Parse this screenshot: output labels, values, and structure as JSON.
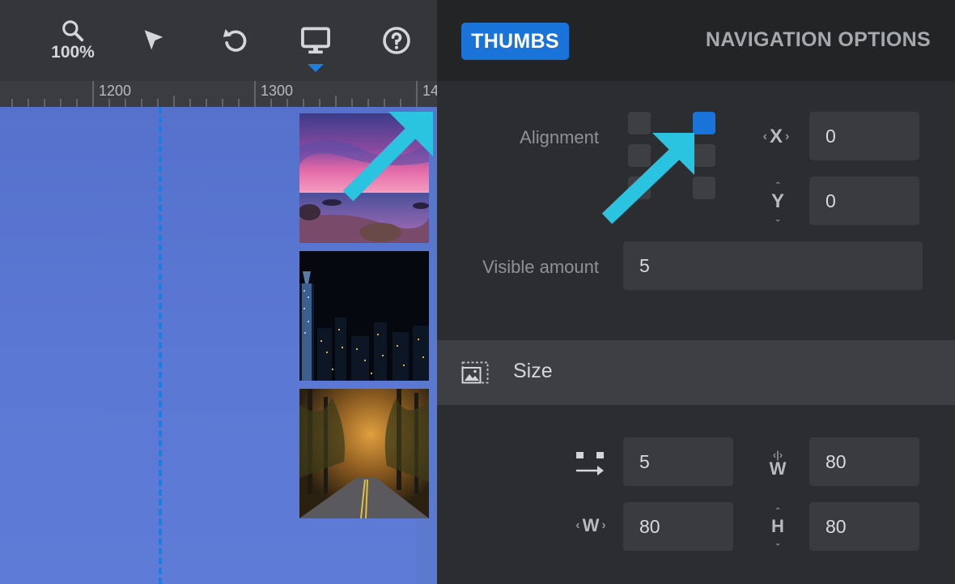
{
  "toolbar": {
    "zoom_label": "100%",
    "tools": [
      "zoom-icon",
      "pointer-icon",
      "undo-icon",
      "desktop-icon",
      "help-icon"
    ],
    "active_tool": "desktop-icon"
  },
  "ruler": {
    "labels": [
      "1200",
      "1300",
      "14"
    ]
  },
  "canvas": {
    "thumbnails": [
      "sunset-beach-image",
      "night-city-image",
      "forest-road-image"
    ]
  },
  "panel": {
    "tabs": {
      "thumbs": "THUMBS",
      "navigation": "NAVIGATION OPTIONS"
    },
    "alignment": {
      "label": "Alignment",
      "selected": "top-right",
      "x_icon": "X",
      "x_value": "0",
      "y_icon": "Y",
      "y_value": "0"
    },
    "visible_amount": {
      "label": "Visible amount",
      "value": "5"
    },
    "size": {
      "title": "Size",
      "spacing_value": "5",
      "width_icon_top": "W",
      "width_value_top": "80",
      "width_icon_left": "W",
      "width_value_left": "80",
      "height_icon": "H",
      "height_value": "80"
    }
  },
  "colors": {
    "accent": "#1a73d9",
    "annotation_arrow": "#2ac3e0",
    "panel_bg": "#2c2d30",
    "field_bg": "#3a3b3f"
  }
}
